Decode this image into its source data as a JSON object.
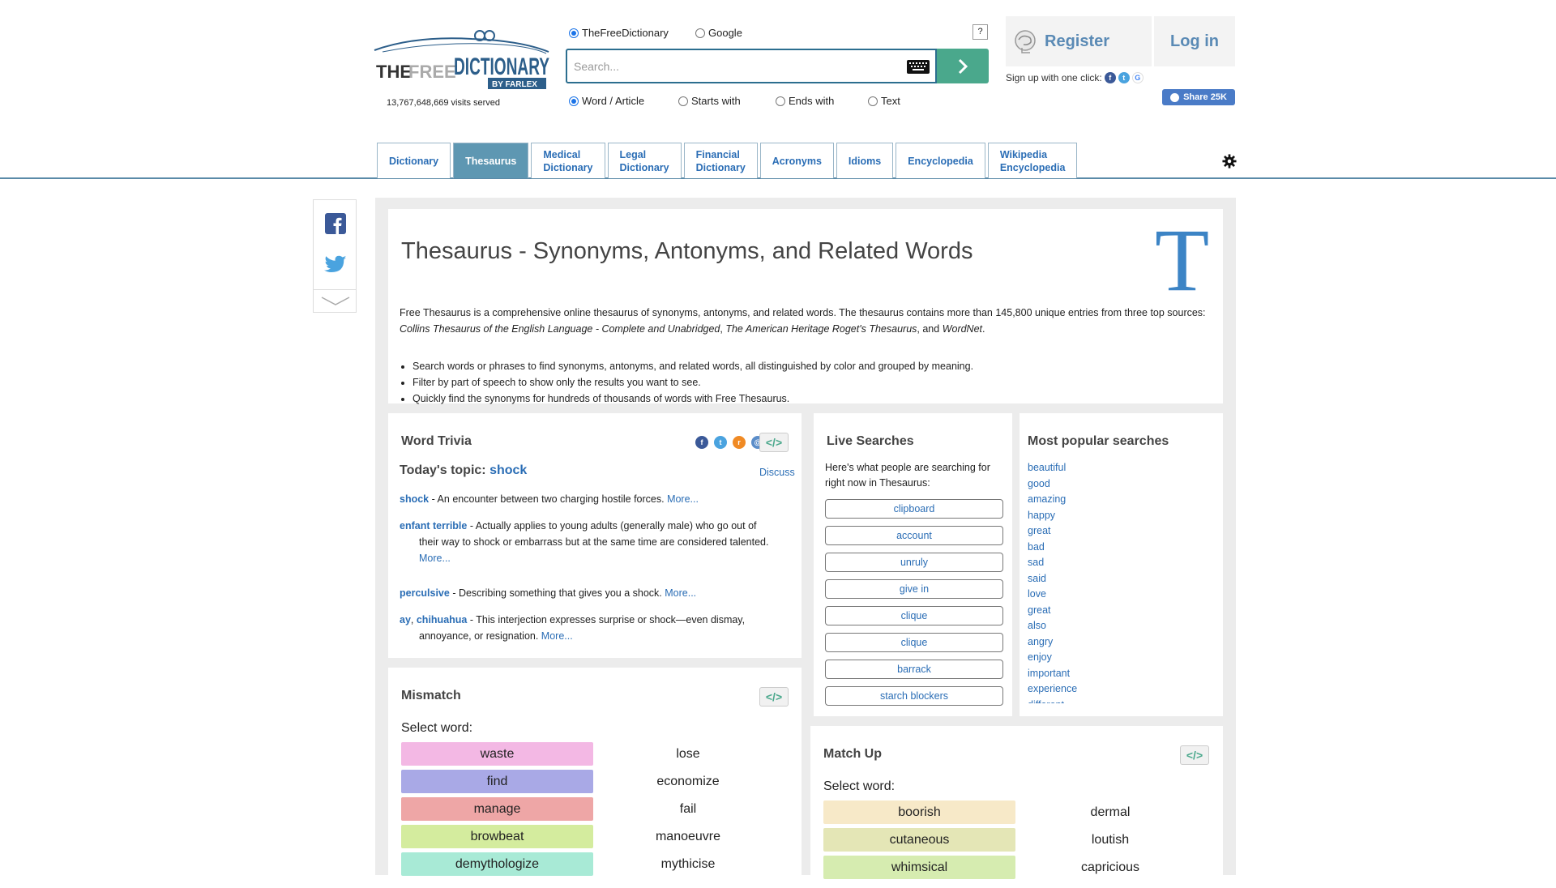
{
  "header": {
    "visits": "13,767,648,669 visits served",
    "search_sources": [
      "TheFreeDictionary",
      "Google"
    ],
    "help_label": "?",
    "search_placeholder": "Search...",
    "search_modes": [
      "Word / Article",
      "Starts with",
      "Ends with",
      "Text"
    ],
    "register_label": "Register",
    "login_label": "Log in",
    "signup_text": "Sign up with one click:",
    "share_label": "Share 25K",
    "tabs": [
      {
        "line1": "Dictionary",
        "line2": ""
      },
      {
        "line1": "Thesaurus",
        "line2": ""
      },
      {
        "line1": "Medical",
        "line2": "Dictionary"
      },
      {
        "line1": "Legal",
        "line2": "Dictionary"
      },
      {
        "line1": "Financial",
        "line2": "Dictionary"
      },
      {
        "line1": "Acronyms",
        "line2": ""
      },
      {
        "line1": "Idioms",
        "line2": ""
      },
      {
        "line1": "Encyclopedia",
        "line2": ""
      },
      {
        "line1": "Wikipedia",
        "line2": "Encyclopedia"
      }
    ],
    "active_tab": "Thesaurus"
  },
  "intro": {
    "title": "Thesaurus - Synonyms, Antonyms, and Related Words",
    "big_letter": "T",
    "para_start": "Free Thesaurus is a comprehensive online thesaurus of synonyms, antonyms, and related words. The thesaurus contains more than 145,800 unique entries from three top sources: ",
    "source1": "Collins Thesaurus of the English Language - Complete and Unabridged",
    "sep1": ", ",
    "source2": "The American Heritage Roget's Thesaurus",
    "sep2": ", and ",
    "source3": "WordNet",
    "para_end": ".",
    "bullets": [
      "Search words or phrases to find synonyms, antonyms, and related words, all distinguished by color and grouped by meaning.",
      "Filter by part of speech to show only the results you want to see.",
      "Quickly find the synonyms for hundreds of thousands of words with Free Thesaurus."
    ]
  },
  "trivia": {
    "heading": "Word Trivia",
    "embed": "</>",
    "topic_prefix": "Today's topic: ",
    "topic_word": "shock",
    "discuss": "Discuss",
    "more": "More...",
    "item1_word": "shock",
    "item1_text": " - An encounter between two charging hostile forces. ",
    "item2_word": "enfant terrible",
    "item2_text_a": " - Actually applies to young adults (generally male) who go out of",
    "item2_text_b": "their way to shock or embarrass but at the same time are considered talented.",
    "item3_word": "perculsive",
    "item3_text": " - Describing something that gives you a shock. ",
    "item4_word_a": "ay",
    "item4_comma": ", ",
    "item4_word_b": "chihuahua",
    "item4_text_a": " - This interjection expresses surprise or shock—even dismay,",
    "item4_text_b": "annoyance, or resignation. "
  },
  "live": {
    "heading": "Live Searches",
    "desc": "Here's what people are searching for right now in Thesaurus:",
    "items": [
      "clipboard",
      "account",
      "unruly",
      "give in",
      "clique",
      "clique",
      "barrack",
      "starch blockers"
    ]
  },
  "popular": {
    "heading": "Most popular searches",
    "items": [
      "beautiful",
      "good",
      "amazing",
      "happy",
      "great",
      "bad",
      "sad",
      "said",
      "love",
      "great",
      "also",
      "angry",
      "enjoy",
      "important",
      "experience",
      "different"
    ]
  },
  "mismatch": {
    "heading": "Mismatch",
    "embed": "</>",
    "select_label": "Select word:",
    "left": [
      "waste",
      "find",
      "manage",
      "browbeat",
      "demythologize"
    ],
    "right": [
      "lose",
      "economize",
      "fail",
      "manoeuvre",
      "mythicise"
    ],
    "colors": [
      "#f3b8e4",
      "#a9a9e6",
      "#eea6a6",
      "#d4ec9e",
      "#a8ead6"
    ]
  },
  "matchup": {
    "heading": "Match Up",
    "embed": "</>",
    "select_label": "Select word:",
    "left": [
      "boorish",
      "cutaneous",
      "whimsical"
    ],
    "right": [
      "dermal",
      "loutish",
      "capricious"
    ],
    "colors": [
      "#f7e9c8",
      "#e4e6b6",
      "#d6ecb0"
    ]
  }
}
